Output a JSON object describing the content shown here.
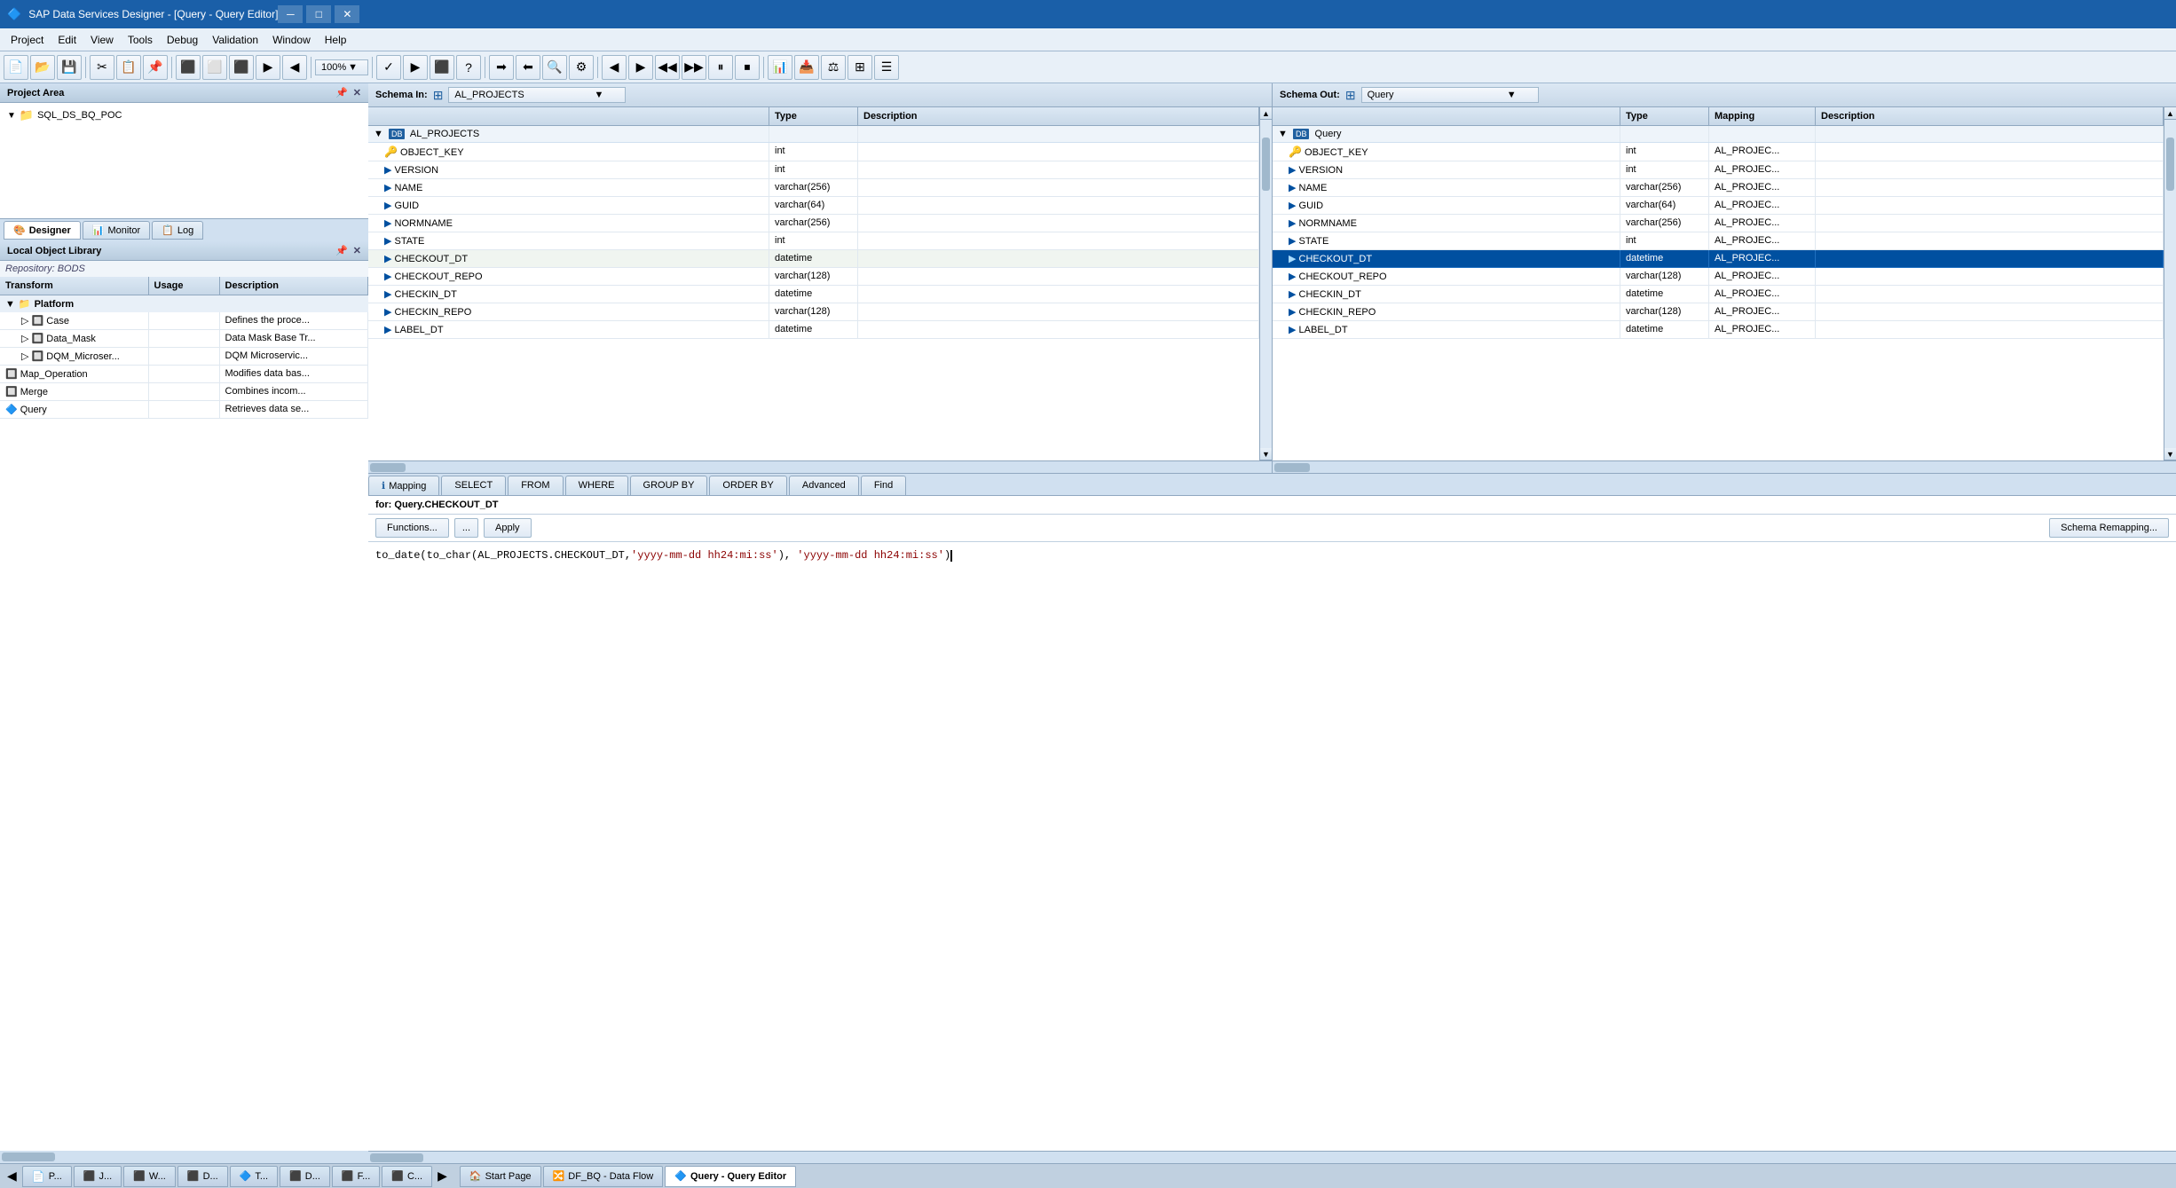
{
  "title_bar": {
    "icon": "SAP",
    "title": "SAP Data Services Designer - [Query - Query Editor]",
    "min": "─",
    "max": "□",
    "close": "✕"
  },
  "menu": {
    "items": [
      "Project",
      "Edit",
      "View",
      "Tools",
      "Debug",
      "Validation",
      "Window",
      "Help"
    ]
  },
  "toolbar": {
    "zoom": "100%"
  },
  "project_area": {
    "title": "Project Area",
    "repository": "SQL_DS_BQ_POC"
  },
  "tabs": {
    "designer": "Designer",
    "monitor": "Monitor",
    "log": "Log"
  },
  "local_lib": {
    "title": "Local Object Library",
    "repository_label": "Repository: BODS",
    "columns": [
      "Transform",
      "Usage",
      "Description"
    ],
    "rows": [
      {
        "name": "Platform",
        "usage": "",
        "desc": "",
        "type": "section"
      },
      {
        "name": "Case",
        "usage": "",
        "desc": "Defines the proce...",
        "type": "item",
        "indent": 1
      },
      {
        "name": "Data_Mask",
        "usage": "",
        "desc": "Data Mask Base Tr...",
        "type": "item",
        "indent": 1
      },
      {
        "name": "DQM_Microser...",
        "usage": "",
        "desc": "DQM Microservic...",
        "type": "item",
        "indent": 1
      },
      {
        "name": "Map_Operation",
        "usage": "",
        "desc": "Modifies data bas...",
        "type": "item",
        "indent": 0
      },
      {
        "name": "Merge",
        "usage": "",
        "desc": "Combines incom...",
        "type": "item",
        "indent": 0
      },
      {
        "name": "Query",
        "usage": "",
        "desc": "Retrieves data se...",
        "type": "item",
        "indent": 0
      }
    ]
  },
  "schema_in": {
    "label": "Schema In:",
    "selected": "AL_PROJECTS",
    "columns": [
      "",
      "Type",
      "Description"
    ],
    "table_name": "AL_PROJECTS",
    "fields": [
      {
        "name": "OBJECT_KEY",
        "type": "int",
        "desc": "",
        "icon": "key"
      },
      {
        "name": "VERSION",
        "type": "int",
        "desc": "",
        "icon": "arrow"
      },
      {
        "name": "NAME",
        "type": "varchar(256)",
        "desc": "",
        "icon": "arrow"
      },
      {
        "name": "GUID",
        "type": "varchar(64)",
        "desc": "",
        "icon": "arrow"
      },
      {
        "name": "NORMNAME",
        "type": "varchar(256)",
        "desc": "",
        "icon": "arrow"
      },
      {
        "name": "STATE",
        "type": "int",
        "desc": "",
        "icon": "arrow"
      },
      {
        "name": "CHECKOUT_DT",
        "type": "datetime",
        "desc": "",
        "icon": "arrow"
      },
      {
        "name": "CHECKOUT_REPO",
        "type": "varchar(128)",
        "desc": "",
        "icon": "arrow"
      },
      {
        "name": "CHECKIN_DT",
        "type": "datetime",
        "desc": "",
        "icon": "arrow"
      },
      {
        "name": "CHECKIN_REPO",
        "type": "varchar(128)",
        "desc": "",
        "icon": "arrow"
      },
      {
        "name": "LABEL_DT",
        "type": "datetime",
        "desc": "",
        "icon": "arrow"
      }
    ]
  },
  "schema_out": {
    "label": "Schema Out:",
    "selected": "Query",
    "columns": [
      "",
      "Type",
      "Mapping",
      "Description"
    ],
    "table_name": "Query",
    "fields": [
      {
        "name": "OBJECT_KEY",
        "type": "int",
        "mapping": "AL_PROJEC...",
        "desc": "",
        "icon": "key",
        "selected": false
      },
      {
        "name": "VERSION",
        "type": "int",
        "mapping": "AL_PROJEC...",
        "desc": "",
        "icon": "arrow",
        "selected": false
      },
      {
        "name": "NAME",
        "type": "varchar(256)",
        "mapping": "AL_PROJEC...",
        "desc": "",
        "icon": "arrow",
        "selected": false
      },
      {
        "name": "GUID",
        "type": "varchar(64)",
        "mapping": "AL_PROJEC...",
        "desc": "",
        "icon": "arrow",
        "selected": false
      },
      {
        "name": "NORMNAME",
        "type": "varchar(256)",
        "mapping": "AL_PROJEC...",
        "desc": "",
        "icon": "arrow",
        "selected": false
      },
      {
        "name": "STATE",
        "type": "int",
        "mapping": "AL_PROJEC...",
        "desc": "",
        "icon": "arrow",
        "selected": false
      },
      {
        "name": "CHECKOUT_DT",
        "type": "datetime",
        "mapping": "AL_PROJEC...",
        "desc": "",
        "icon": "arrow",
        "selected": true
      },
      {
        "name": "CHECKOUT_REPO",
        "type": "varchar(128)",
        "mapping": "AL_PROJEC...",
        "desc": "",
        "icon": "arrow",
        "selected": false
      },
      {
        "name": "CHECKIN_DT",
        "type": "datetime",
        "mapping": "AL_PROJEC...",
        "desc": "",
        "icon": "arrow",
        "selected": false
      },
      {
        "name": "CHECKIN_REPO",
        "type": "varchar(128)",
        "mapping": "AL_PROJEC...",
        "desc": "",
        "icon": "arrow",
        "selected": false
      },
      {
        "name": "LABEL_DT",
        "type": "datetime",
        "mapping": "AL_PROJEC...",
        "desc": "",
        "icon": "arrow",
        "selected": false
      }
    ]
  },
  "editor_tabs": [
    "Mapping",
    "SELECT",
    "FROM",
    "WHERE",
    "GROUP BY",
    "ORDER BY",
    "Advanced",
    "Find"
  ],
  "active_tab": "Mapping",
  "mapping_for": "for: Query.CHECKOUT_DT",
  "buttons": {
    "functions": "Functions...",
    "dots": "...",
    "apply": "Apply",
    "schema_remap": "Schema Remapping..."
  },
  "expression": {
    "part1": "to_date(to_char(AL_PROJECTS.CHECKOUT_DT,",
    "string1": "'yyyy-mm-dd hh24:mi:ss'",
    "part2": "), ",
    "string2": "'yyyy-mm-dd hh24:mi:ss'",
    "part3": ")"
  },
  "status_bar": {
    "tabs": [
      "P...",
      "J...",
      "W...",
      "D...",
      "T...",
      "D...",
      "F...",
      "C..."
    ],
    "start_page": "Start Page",
    "data_flow": "DF_BQ - Data Flow",
    "query_editor": "Query - Query Editor",
    "active": "Query - Query Editor"
  }
}
